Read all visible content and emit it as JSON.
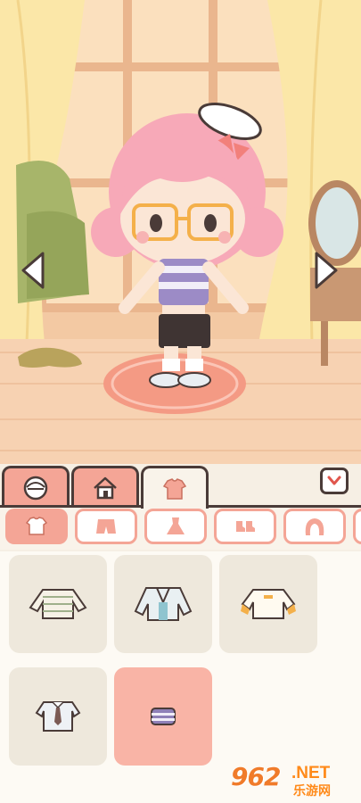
{
  "scene": {
    "left_arrow": "arrow-left",
    "right_arrow": "arrow-right"
  },
  "tabs": [
    {
      "icon": "face-icon",
      "active": false
    },
    {
      "icon": "house-icon",
      "active": false
    },
    {
      "icon": "shirt-icon",
      "active": true
    }
  ],
  "collapse_icon": "chevron-down-icon",
  "subcategories": [
    {
      "icon": "top-icon",
      "active": true
    },
    {
      "icon": "shorts-icon",
      "active": false
    },
    {
      "icon": "dress-icon",
      "active": false
    },
    {
      "icon": "shoes-icon",
      "active": false
    },
    {
      "icon": "hair-icon",
      "active": false
    }
  ],
  "items": [
    {
      "icon": "striped-sweater-icon",
      "selected": false
    },
    {
      "icon": "open-jacket-icon",
      "selected": false
    },
    {
      "icon": "sweatshirt-icon",
      "selected": false
    },
    {
      "icon": "collared-shirt-tie-icon",
      "selected": false
    },
    {
      "icon": "crop-top-icon",
      "selected": true
    }
  ],
  "watermark": {
    "number": "962",
    "suffix": ".NET",
    "site": "乐游网"
  },
  "colors": {
    "accent": "#f4a596",
    "outline": "#4a3b38",
    "selected": "#f9b4a6",
    "panel": "#f6efe4"
  }
}
